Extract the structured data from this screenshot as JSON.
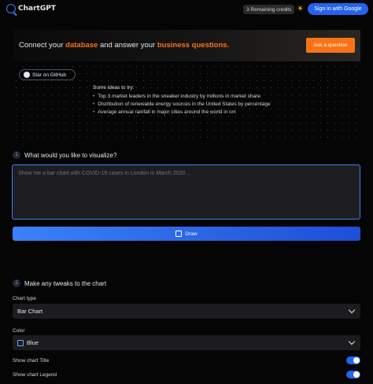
{
  "header": {
    "app_name": "ChartGPT",
    "credits": "3 Remaining credits",
    "theme_icon": "sun-icon",
    "signin_label": "Sign in with Google"
  },
  "hero": {
    "prefix": "Connect your ",
    "highlight1": "database",
    "middle": " and answer your ",
    "highlight2": "business questions.",
    "ask_label": "Ask a question"
  },
  "github": {
    "label": "Star on GitHub"
  },
  "ideas": {
    "title": "Some ideas to try:",
    "items": [
      "Top 3 market leaders in the sneaker industry by millions in market share",
      "Distribution of renewable energy sources in the United States by percentage",
      "Average annual rainfall in major cities around the world in cm"
    ]
  },
  "step1": {
    "number": "1",
    "label": "What would you like to visualize?"
  },
  "prompt": {
    "placeholder": "Show me a bar chart with COVID-19 cases in London in March 2020...",
    "value": ""
  },
  "draw_label": "Draw",
  "step2": {
    "number": "2",
    "label": "Make any tweaks to the chart"
  },
  "chart_type": {
    "label": "Chart type",
    "selected": "Bar Chart"
  },
  "color": {
    "label": "Color",
    "selected": "Blue"
  },
  "toggles": [
    {
      "label": "Show chart Title",
      "on": true
    },
    {
      "label": "Show chart Legend",
      "on": true
    }
  ],
  "colors": {
    "accent": "#2563eb",
    "highlight": "#f97316",
    "background": "#050505"
  }
}
